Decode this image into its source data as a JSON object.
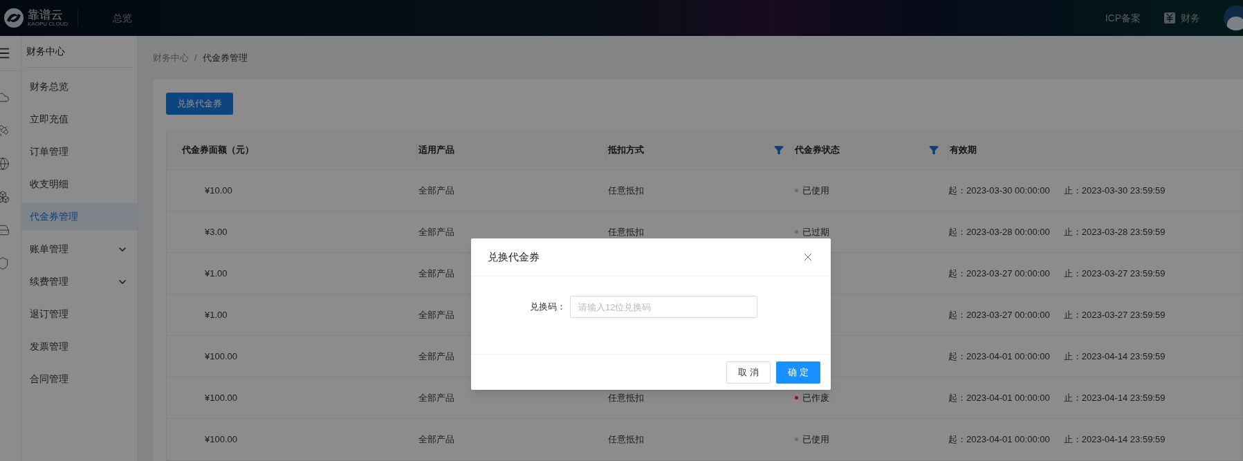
{
  "top_bar": {
    "logo": {
      "name": "靠谱云",
      "subtitle": "KAOPU CLOUD"
    },
    "nav": [
      {
        "label": "总览"
      }
    ],
    "links": [
      {
        "label": "ICP备案",
        "kind": "text"
      },
      {
        "label": "财务",
        "kind": "icon"
      }
    ]
  },
  "sidebar": {
    "title": "财务中心",
    "items": [
      {
        "label": "财务总览",
        "selected": false,
        "submenu": false
      },
      {
        "label": "立即充值",
        "selected": false,
        "submenu": false
      },
      {
        "label": "订单管理",
        "selected": false,
        "submenu": false
      },
      {
        "label": "收支明细",
        "selected": false,
        "submenu": false
      },
      {
        "label": "代金券管理",
        "selected": true,
        "submenu": false
      },
      {
        "label": "账单管理",
        "selected": false,
        "submenu": true
      },
      {
        "label": "续费管理",
        "selected": false,
        "submenu": true
      },
      {
        "label": "退订管理",
        "selected": false,
        "submenu": false
      },
      {
        "label": "发票管理",
        "selected": false,
        "submenu": false
      },
      {
        "label": "合同管理",
        "selected": false,
        "submenu": false
      }
    ]
  },
  "breadcrumb": {
    "items": [
      "财务中心",
      "代金券管理"
    ],
    "separator": "/"
  },
  "redeem_button": "兑换代金券",
  "table": {
    "columns": [
      {
        "label": "代金券面额（元）",
        "filter": false
      },
      {
        "label": "适用产品",
        "filter": false
      },
      {
        "label": "抵扣方式",
        "filter": true
      },
      {
        "label": "代金券状态",
        "filter": true
      },
      {
        "label": "有效期",
        "filter": false
      }
    ],
    "rows": [
      {
        "amount": "¥10.00",
        "product": "全部产品",
        "method": "任意抵扣",
        "status": {
          "label": "已使用",
          "color": "#6b6b6b"
        },
        "start": "起：2023-03-30 00:00:00",
        "end": "止：2023-03-30 23:59:59"
      },
      {
        "amount": "¥3.00",
        "product": "全部产品",
        "method": "任意抵扣",
        "status": {
          "label": "已过期",
          "color": "#6b6b6b"
        },
        "start": "起：2023-03-28 00:00:00",
        "end": "止：2023-03-28 23:59:59"
      },
      {
        "amount": "¥1.00",
        "product": "全部产品",
        "method": null,
        "status": null,
        "start": "起：2023-03-27 00:00:00",
        "end": "止：2023-03-27 23:59:59"
      },
      {
        "amount": "¥1.00",
        "product": "全部产品",
        "method": null,
        "status": null,
        "start": "起：2023-03-27 00:00:00",
        "end": "止：2023-03-27 23:59:59"
      },
      {
        "amount": "¥100.00",
        "product": "全部产品",
        "method": null,
        "status": null,
        "start": "起：2023-04-01 00:00:00",
        "end": "止：2023-04-14 23:59:59"
      },
      {
        "amount": "¥100.00",
        "product": "全部产品",
        "method": "任意抵扣",
        "status": {
          "label": "已作废",
          "color": "#9a1414"
        },
        "start": "起：2023-04-01 00:00:00",
        "end": "止：2023-04-14 23:59:59"
      },
      {
        "amount": "¥100.00",
        "product": "全部产品",
        "method": "任意抵扣",
        "status": {
          "label": "已使用",
          "color": "#6b6b6b"
        },
        "start": "起：2023-04-01 00:00:00",
        "end": "止：2023-04-14 23:59:59"
      }
    ]
  },
  "dialog": {
    "title": "兑换代金券",
    "field": {
      "label": "兑换码：",
      "placeholder": "请输入12位兑换码"
    },
    "buttons": [
      {
        "label": "取 消",
        "kind": "secondary"
      },
      {
        "label": "确 定",
        "kind": "primary"
      }
    ]
  }
}
